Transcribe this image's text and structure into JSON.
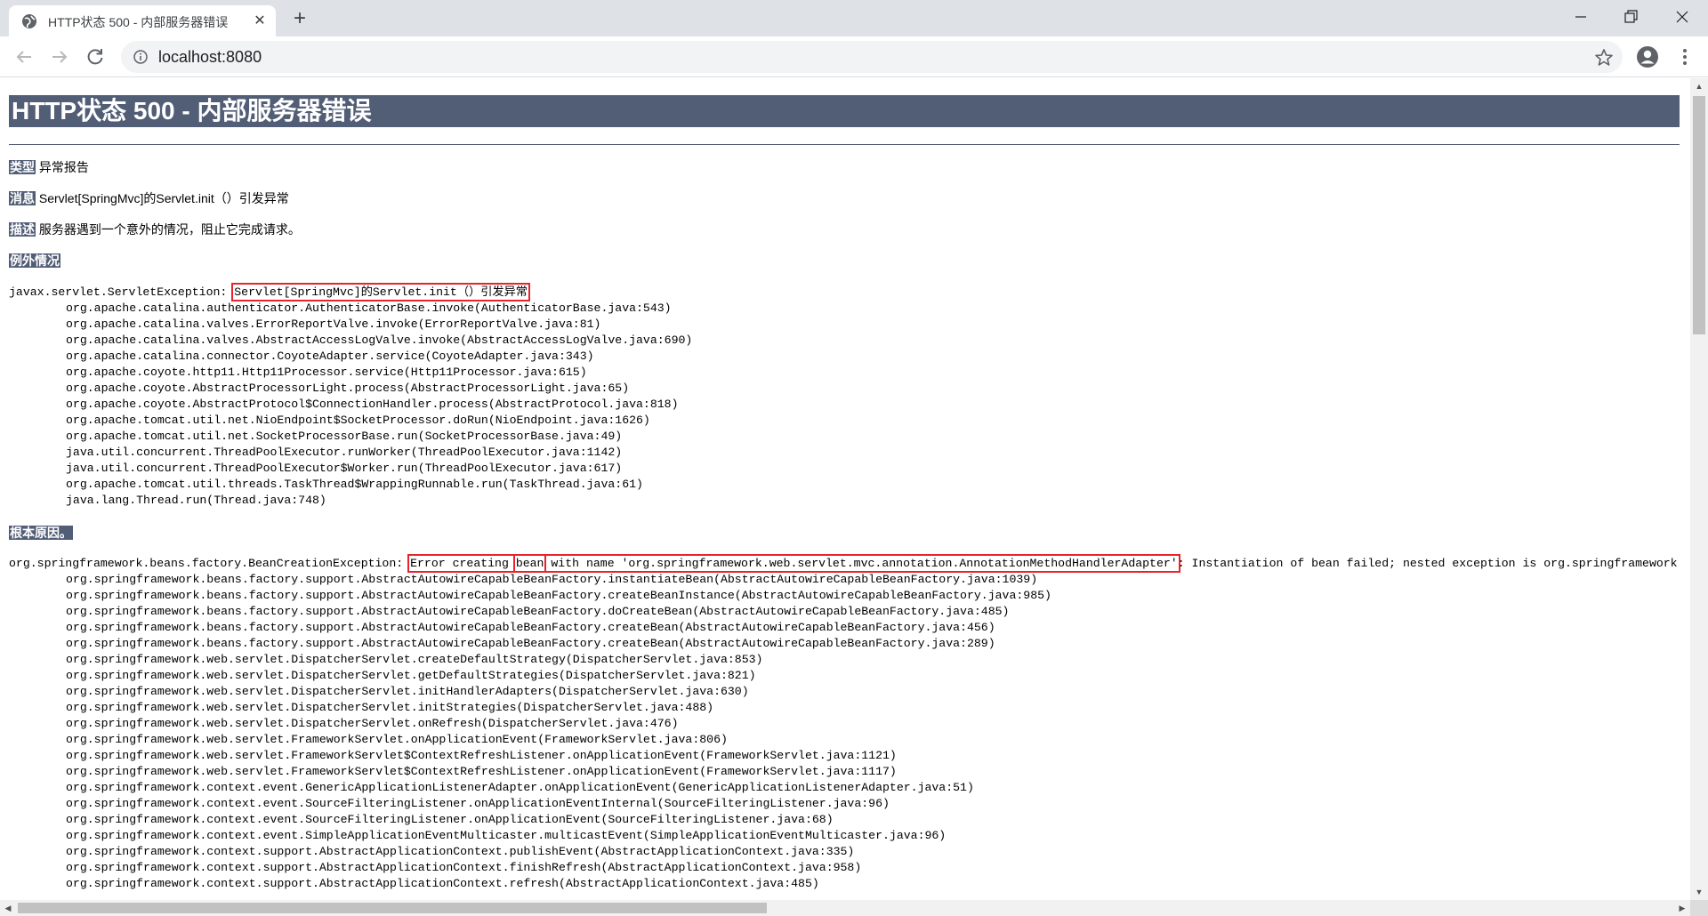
{
  "browser": {
    "tab_title": "HTTP状态 500 - 内部服务器错误",
    "tab_close": "✕",
    "new_tab": "+",
    "url": "localhost:8080"
  },
  "page": {
    "title": "HTTP状态 500 - 内部服务器错误",
    "type_label": "类型",
    "type_value": "异常报告",
    "message_label": "消息",
    "message_value": "Servlet[SpringMvc]的Servlet.init（）引发异常",
    "description_label": "描述",
    "description_value": "服务器遇到一个意外的情况，阻止它完成请求。",
    "exception_label": "例外情况",
    "root_cause_label": "根本原因。"
  },
  "exception": {
    "prefix": "javax.servlet.ServletException: ",
    "highlight": "Servlet[SpringMvc]的Servlet.init（）引发异常",
    "frames": [
      "org.apache.catalina.authenticator.AuthenticatorBase.invoke(AuthenticatorBase.java:543)",
      "org.apache.catalina.valves.ErrorReportValve.invoke(ErrorReportValve.java:81)",
      "org.apache.catalina.valves.AbstractAccessLogValve.invoke(AbstractAccessLogValve.java:690)",
      "org.apache.catalina.connector.CoyoteAdapter.service(CoyoteAdapter.java:343)",
      "org.apache.coyote.http11.Http11Processor.service(Http11Processor.java:615)",
      "org.apache.coyote.AbstractProcessorLight.process(AbstractProcessorLight.java:65)",
      "org.apache.coyote.AbstractProtocol$ConnectionHandler.process(AbstractProtocol.java:818)",
      "org.apache.tomcat.util.net.NioEndpoint$SocketProcessor.doRun(NioEndpoint.java:1626)",
      "org.apache.tomcat.util.net.SocketProcessorBase.run(SocketProcessorBase.java:49)",
      "java.util.concurrent.ThreadPoolExecutor.runWorker(ThreadPoolExecutor.java:1142)",
      "java.util.concurrent.ThreadPoolExecutor$Worker.run(ThreadPoolExecutor.java:617)",
      "org.apache.tomcat.util.threads.TaskThread$WrappingRunnable.run(TaskThread.java:61)",
      "java.lang.Thread.run(Thread.java:748)"
    ]
  },
  "root_cause": {
    "prefix": "org.springframework.beans.factory.BeanCreationException: ",
    "highlight_a": "Error creating ",
    "highlight_bean": "bean",
    "highlight_b": " with name 'org.springframework.web.servlet.mvc.annotation.AnnotationMethodHandlerAdapter'",
    "suffix": ": Instantiation of bean failed; nested exception is org.springframework",
    "frames": [
      "org.springframework.beans.factory.support.AbstractAutowireCapableBeanFactory.instantiateBean(AbstractAutowireCapableBeanFactory.java:1039)",
      "org.springframework.beans.factory.support.AbstractAutowireCapableBeanFactory.createBeanInstance(AbstractAutowireCapableBeanFactory.java:985)",
      "org.springframework.beans.factory.support.AbstractAutowireCapableBeanFactory.doCreateBean(AbstractAutowireCapableBeanFactory.java:485)",
      "org.springframework.beans.factory.support.AbstractAutowireCapableBeanFactory.createBean(AbstractAutowireCapableBeanFactory.java:456)",
      "org.springframework.beans.factory.support.AbstractAutowireCapableBeanFactory.createBean(AbstractAutowireCapableBeanFactory.java:289)",
      "org.springframework.web.servlet.DispatcherServlet.createDefaultStrategy(DispatcherServlet.java:853)",
      "org.springframework.web.servlet.DispatcherServlet.getDefaultStrategies(DispatcherServlet.java:821)",
      "org.springframework.web.servlet.DispatcherServlet.initHandlerAdapters(DispatcherServlet.java:630)",
      "org.springframework.web.servlet.DispatcherServlet.initStrategies(DispatcherServlet.java:488)",
      "org.springframework.web.servlet.DispatcherServlet.onRefresh(DispatcherServlet.java:476)",
      "org.springframework.web.servlet.FrameworkServlet.onApplicationEvent(FrameworkServlet.java:806)",
      "org.springframework.web.servlet.FrameworkServlet$ContextRefreshListener.onApplicationEvent(FrameworkServlet.java:1121)",
      "org.springframework.web.servlet.FrameworkServlet$ContextRefreshListener.onApplicationEvent(FrameworkServlet.java:1117)",
      "org.springframework.context.event.GenericApplicationListenerAdapter.onApplicationEvent(GenericApplicationListenerAdapter.java:51)",
      "org.springframework.context.event.SourceFilteringListener.onApplicationEventInternal(SourceFilteringListener.java:96)",
      "org.springframework.context.event.SourceFilteringListener.onApplicationEvent(SourceFilteringListener.java:68)",
      "org.springframework.context.event.SimpleApplicationEventMulticaster.multicastEvent(SimpleApplicationEventMulticaster.java:96)",
      "org.springframework.context.support.AbstractApplicationContext.publishEvent(AbstractApplicationContext.java:335)",
      "org.springframework.context.support.AbstractApplicationContext.finishRefresh(AbstractApplicationContext.java:958)",
      "org.springframework.context.support.AbstractApplicationContext.refresh(AbstractApplicationContext.java:485)"
    ]
  },
  "colors": {
    "header_bg": "#525d76",
    "highlight_box": "#e8232c"
  },
  "icons": {
    "tab_favicon": "globe-icon",
    "back": "back-arrow-icon",
    "forward": "forward-arrow-icon",
    "reload": "reload-icon",
    "info": "info-icon",
    "bookmark": "star-icon",
    "profile": "profile-icon",
    "menu": "kebab-menu-icon"
  }
}
